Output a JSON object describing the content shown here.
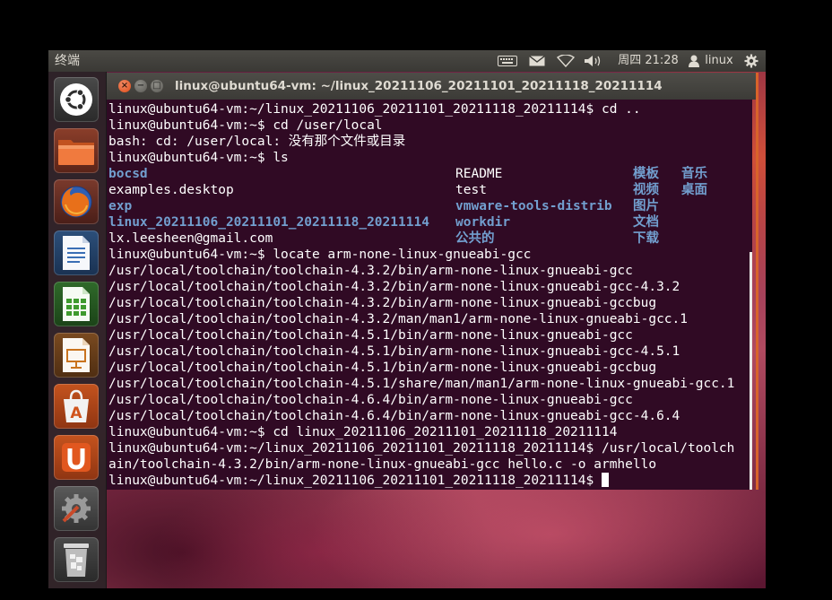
{
  "panel": {
    "title": "终端",
    "clock": "周四 21:28",
    "user": "linux",
    "icons": [
      "keyboard-icon",
      "mail-icon",
      "network-icon",
      "volume-icon",
      "user-icon",
      "gear-icon"
    ]
  },
  "launcher": {
    "items": [
      "ubuntu-dash",
      "home-folder",
      "firefox",
      "libreoffice-writer",
      "libreoffice-calc",
      "libreoffice-impress",
      "ubuntu-software-center",
      "ubuntu-one",
      "system-settings",
      "trash"
    ]
  },
  "window": {
    "title": "linux@ubuntu64-vm: ~/linux_20211106_20211101_20211118_20211114",
    "buttons": {
      "close": "×",
      "minimize": "−",
      "maximize": "□"
    }
  },
  "terminal": {
    "lines": [
      "linux@ubuntu64-vm:~/linux_20211106_20211101_20211118_20211114$ cd ..",
      "linux@ubuntu64-vm:~$ cd /user/local",
      "bash: cd: /user/local: 没有那个文件或目录",
      "linux@ubuntu64-vm:~$ ls",
      "linux@ubuntu64-vm:~$ locate arm-none-linux-gnueabi-gcc",
      "/usr/local/toolchain/toolchain-4.3.2/bin/arm-none-linux-gnueabi-gcc",
      "/usr/local/toolchain/toolchain-4.3.2/bin/arm-none-linux-gnueabi-gcc-4.3.2",
      "/usr/local/toolchain/toolchain-4.3.2/bin/arm-none-linux-gnueabi-gccbug",
      "/usr/local/toolchain/toolchain-4.3.2/man/man1/arm-none-linux-gnueabi-gcc.1",
      "/usr/local/toolchain/toolchain-4.5.1/bin/arm-none-linux-gnueabi-gcc",
      "/usr/local/toolchain/toolchain-4.5.1/bin/arm-none-linux-gnueabi-gcc-4.5.1",
      "/usr/local/toolchain/toolchain-4.5.1/bin/arm-none-linux-gnueabi-gccbug",
      "/usr/local/toolchain/toolchain-4.5.1/share/man/man1/arm-none-linux-gnueabi-gcc.1",
      "/usr/local/toolchain/toolchain-4.6.4/bin/arm-none-linux-gnueabi-gcc",
      "/usr/local/toolchain/toolchain-4.6.4/bin/arm-none-linux-gnueabi-gcc-4.6.4",
      "linux@ubuntu64-vm:~$ cd linux_20211106_20211101_20211118_20211114",
      "linux@ubuntu64-vm:~/linux_20211106_20211101_20211118_20211114$ /usr/local/toolch",
      "ain/toolchain-4.3.2/bin/arm-none-linux-gnueabi-gcc hello.c -o armhello",
      "linux@ubuntu64-vm:~/linux_20211106_20211101_20211118_20211114$ "
    ],
    "ls": {
      "col1": [
        {
          "name": "bocsd",
          "dir": true
        },
        {
          "name": "examples.desktop",
          "dir": false
        },
        {
          "name": "exp",
          "dir": true
        },
        {
          "name": "linux_20211106_20211101_20211118_20211114",
          "dir": true
        },
        {
          "name": "lx.leesheen@gmail.com",
          "dir": false
        }
      ],
      "col2": [
        {
          "name": "README",
          "dir": false
        },
        {
          "name": "test",
          "dir": false
        },
        {
          "name": "vmware-tools-distrib",
          "dir": true
        },
        {
          "name": "workdir",
          "dir": true
        },
        {
          "name": "公共的",
          "dir": true
        }
      ],
      "col3": [
        {
          "name": "模板",
          "dir": true
        },
        {
          "name": "视频",
          "dir": true
        },
        {
          "name": "图片",
          "dir": true
        },
        {
          "name": "文档",
          "dir": true
        },
        {
          "name": "下载",
          "dir": true
        }
      ],
      "col4": [
        {
          "name": "音乐",
          "dir": true
        },
        {
          "name": "桌面",
          "dir": true
        }
      ]
    },
    "colors": {
      "background": "#300a24",
      "text": "#ffffff",
      "directory": "#729fcf"
    }
  }
}
